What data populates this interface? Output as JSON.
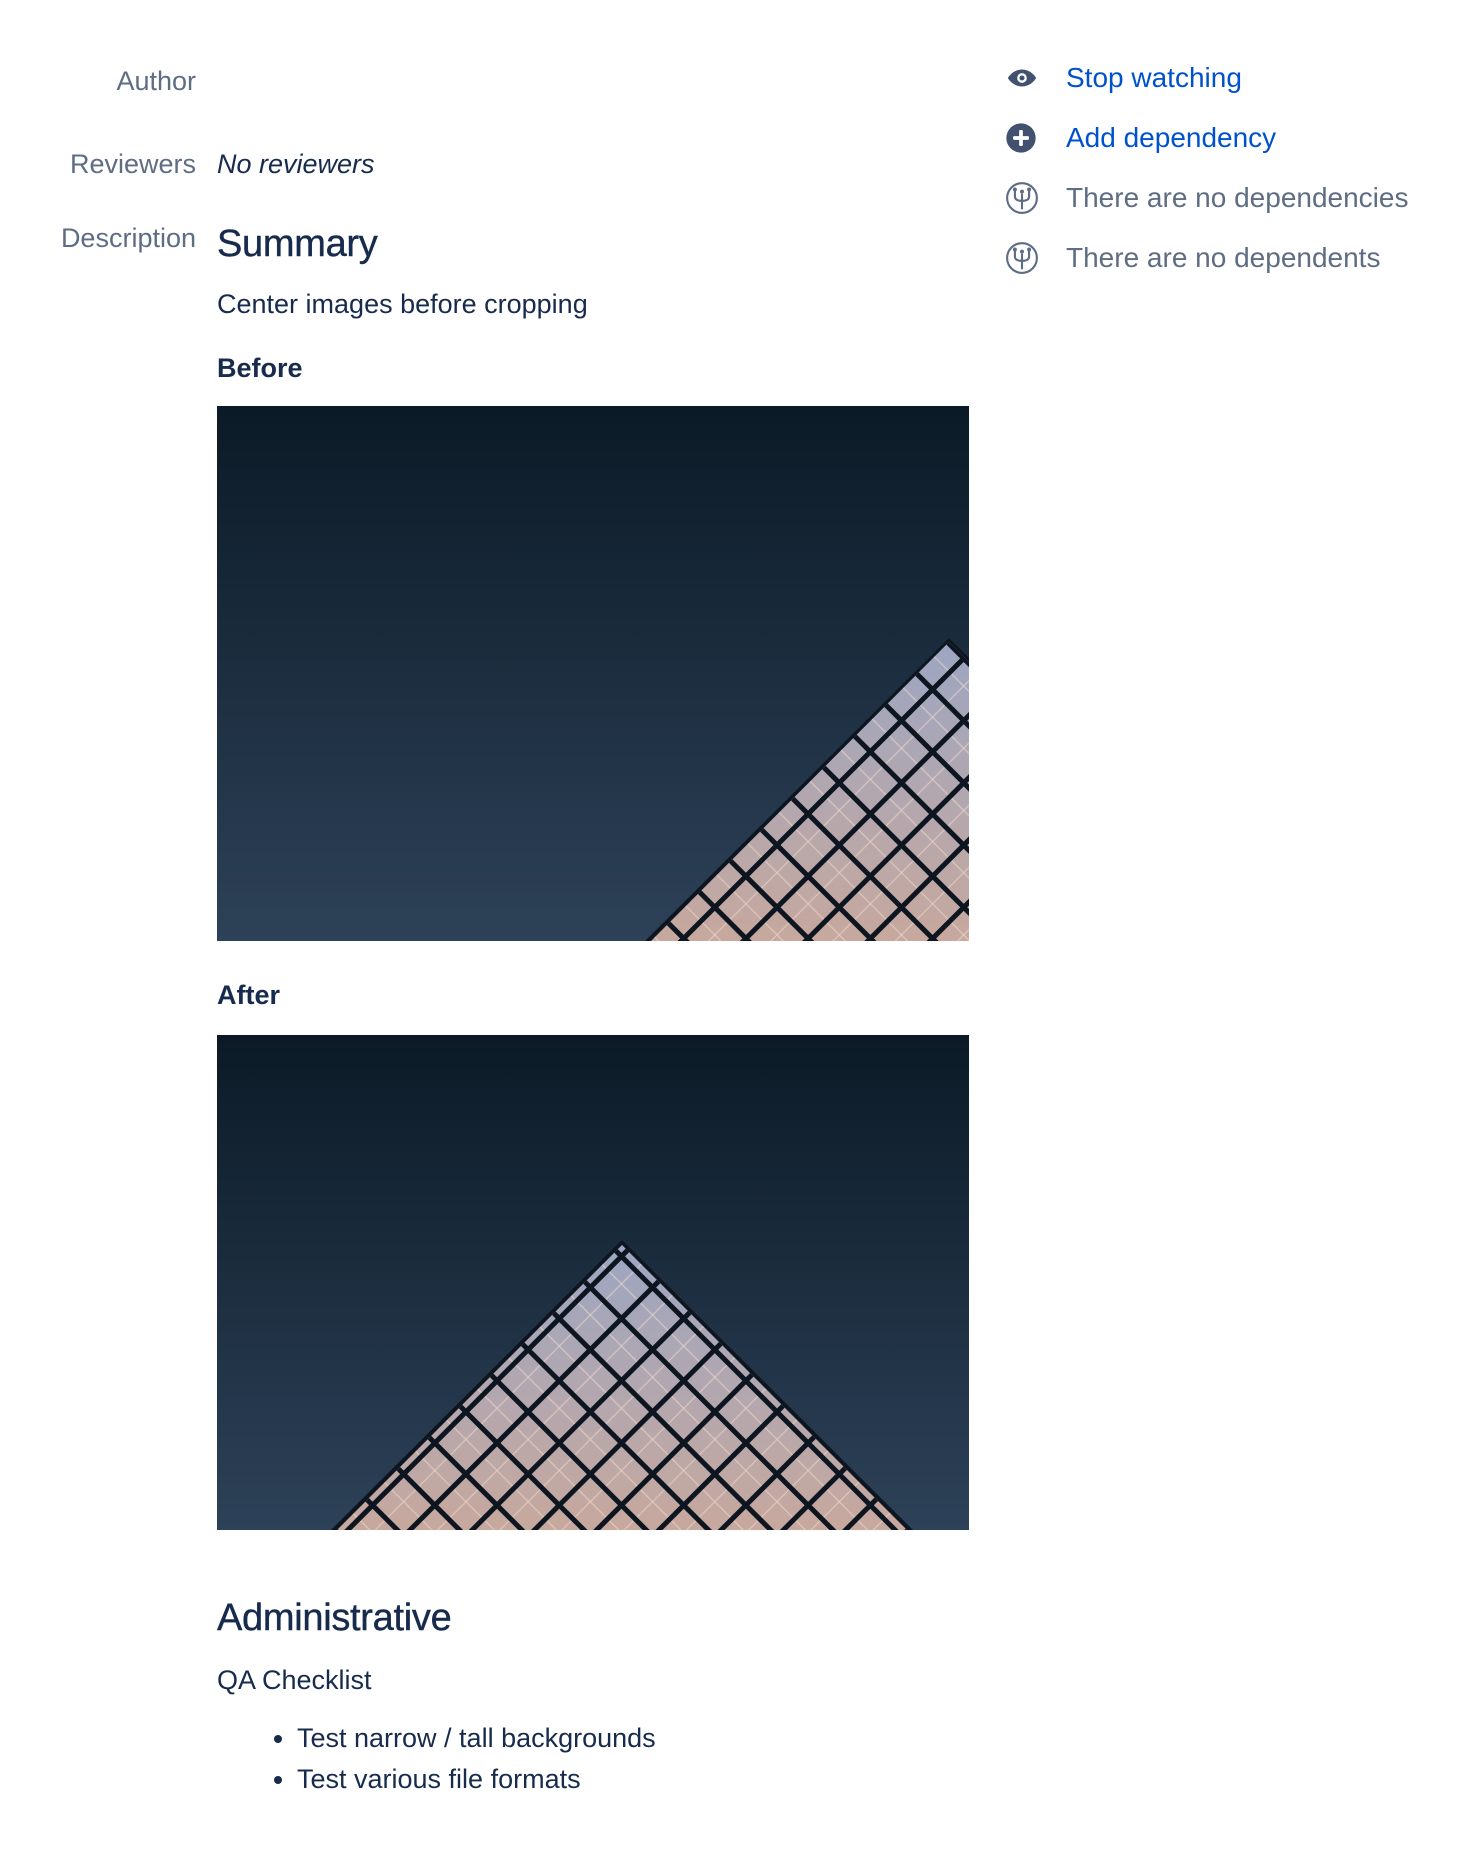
{
  "fields": {
    "author_label": "Author",
    "reviewers_label": "Reviewers",
    "reviewers_value": "No reviewers",
    "description_label": "Description"
  },
  "description": {
    "summary_heading": "Summary",
    "summary_text": "Center images before cropping",
    "before_label": "Before",
    "after_label": "After",
    "admin_heading": "Administrative",
    "qa_label": "QA Checklist",
    "qa_items": [
      "Test narrow / tall backgrounds",
      "Test various file formats"
    ]
  },
  "sidebar": {
    "stop_watching": "Stop watching",
    "add_dependency": "Add dependency",
    "no_dependencies": "There are no dependencies",
    "no_dependents": "There are no dependents",
    "icons": [
      "eye-icon",
      "add-circle-icon",
      "dependency-icon",
      "dependency-icon"
    ]
  },
  "colors": {
    "text": "#172b4d",
    "muted": "#5e6c84",
    "link": "#0052cc",
    "sky_top": "#0b1a26",
    "sky_bottom": "#2d4158"
  }
}
